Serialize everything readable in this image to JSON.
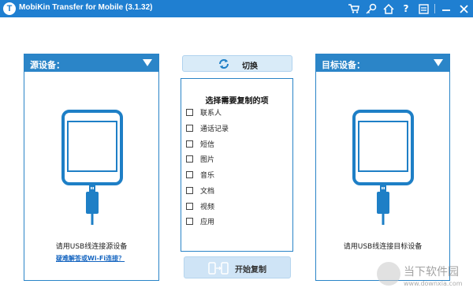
{
  "window": {
    "title": "MobiKin Transfer for Mobile  (3.1.32)",
    "logo_letter": "T"
  },
  "titlebar_icons": [
    "cart-icon",
    "key-icon",
    "home-icon",
    "help-icon",
    "feedback-icon",
    "minimize-icon",
    "close-icon"
  ],
  "source_panel": {
    "title": "源设备：",
    "connect_text": "请用USB线连接源设备",
    "help_link": "疑难解答或Wi-Fi连接？"
  },
  "target_panel": {
    "title": "目标设备：",
    "connect_text": "请用USB线连接目标设备"
  },
  "switch_button": {
    "label": "切换"
  },
  "items": {
    "title": "选择需要复制的项",
    "list": [
      {
        "label": "联系人",
        "checked": false
      },
      {
        "label": "通话记录",
        "checked": false
      },
      {
        "label": "短信",
        "checked": false
      },
      {
        "label": "图片",
        "checked": false
      },
      {
        "label": "音乐",
        "checked": false
      },
      {
        "label": "文档",
        "checked": false
      },
      {
        "label": "视频",
        "checked": false
      },
      {
        "label": "应用",
        "checked": false
      }
    ]
  },
  "start_button": {
    "label": "开始复制"
  },
  "watermark": {
    "text": "当下软件园",
    "url": "www.downxia.com"
  },
  "colors": {
    "titlebar": "#1f7fd1",
    "panel_header": "#2b85c8",
    "phone": "#1e7fc6",
    "button_bg": "#d9ebf8"
  }
}
